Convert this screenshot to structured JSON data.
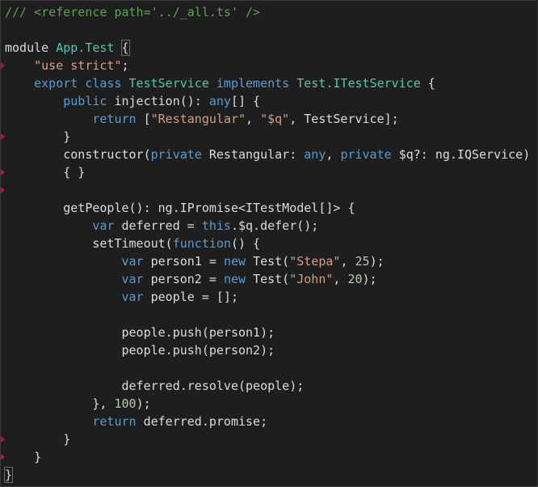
{
  "editor": {
    "colors": {
      "background": "#1e1e1e",
      "comment": "#57a64a",
      "keyword": "#569cd6",
      "string": "#d69d85",
      "number": "#b5cea8",
      "type": "#4ec9b0",
      "plain": "#dcdcdc",
      "error_marker": "#c8102e"
    },
    "error_marker_lines": [
      3,
      7,
      9,
      10,
      24,
      25
    ],
    "lines": [
      [
        [
          "comment",
          "/// <reference path='../_all.ts' />"
        ]
      ],
      [],
      [
        [
          "plain",
          "module "
        ],
        [
          "type",
          "App.Test"
        ],
        [
          "plain",
          " {"
        ]
      ],
      [
        [
          "plain",
          "    "
        ],
        [
          "string",
          "\"use strict\""
        ],
        [
          "plain",
          ";"
        ]
      ],
      [
        [
          "plain",
          "    "
        ],
        [
          "keyword",
          "export class "
        ],
        [
          "type",
          "TestService"
        ],
        [
          "keyword",
          " implements "
        ],
        [
          "type",
          "Test.ITestService"
        ],
        [
          "plain",
          " {"
        ]
      ],
      [
        [
          "plain",
          "        "
        ],
        [
          "keyword",
          "public "
        ],
        [
          "plain",
          "injection(): "
        ],
        [
          "keyword",
          "any"
        ],
        [
          "plain",
          "[] {"
        ]
      ],
      [
        [
          "plain",
          "            "
        ],
        [
          "keyword",
          "return "
        ],
        [
          "plain",
          "["
        ],
        [
          "string",
          "\"Restangular\""
        ],
        [
          "plain",
          ", "
        ],
        [
          "string",
          "\"$q\""
        ],
        [
          "plain",
          ", TestService];"
        ]
      ],
      [
        [
          "plain",
          "        }"
        ]
      ],
      [
        [
          "plain",
          "        "
        ],
        [
          "plain",
          "constructor("
        ],
        [
          "keyword",
          "private "
        ],
        [
          "plain",
          "Restangular: "
        ],
        [
          "keyword",
          "any"
        ],
        [
          "plain",
          ", "
        ],
        [
          "keyword",
          "private "
        ],
        [
          "plain",
          "$q?: ng.IQService)"
        ]
      ],
      [
        [
          "plain",
          "        { }"
        ]
      ],
      [],
      [
        [
          "plain",
          "        getPeople(): ng.IPromise<ITestModel[]> {"
        ]
      ],
      [
        [
          "plain",
          "            "
        ],
        [
          "keyword",
          "var "
        ],
        [
          "plain",
          "deferred = "
        ],
        [
          "keyword",
          "this"
        ],
        [
          "plain",
          ".$q.defer();"
        ]
      ],
      [
        [
          "plain",
          "            setTimeout("
        ],
        [
          "keyword",
          "function"
        ],
        [
          "plain",
          "() {"
        ]
      ],
      [
        [
          "plain",
          "                "
        ],
        [
          "keyword",
          "var "
        ],
        [
          "plain",
          "person1 = "
        ],
        [
          "keyword",
          "new "
        ],
        [
          "plain",
          "Test("
        ],
        [
          "string",
          "\"Stepa\""
        ],
        [
          "plain",
          ", "
        ],
        [
          "number",
          "25"
        ],
        [
          "plain",
          ");"
        ]
      ],
      [
        [
          "plain",
          "                "
        ],
        [
          "keyword",
          "var "
        ],
        [
          "plain",
          "person2 = "
        ],
        [
          "keyword",
          "new "
        ],
        [
          "plain",
          "Test("
        ],
        [
          "string",
          "\"John\""
        ],
        [
          "plain",
          ", "
        ],
        [
          "number",
          "20"
        ],
        [
          "plain",
          ");"
        ]
      ],
      [
        [
          "plain",
          "                "
        ],
        [
          "keyword",
          "var "
        ],
        [
          "plain",
          "people = [];"
        ]
      ],
      [],
      [
        [
          "plain",
          "                people.push(person1);"
        ]
      ],
      [
        [
          "plain",
          "                people.push(person2);"
        ]
      ],
      [],
      [
        [
          "plain",
          "                deferred.resolve(people);"
        ]
      ],
      [
        [
          "plain",
          "            }, "
        ],
        [
          "number",
          "100"
        ],
        [
          "plain",
          ");"
        ]
      ],
      [
        [
          "plain",
          "            "
        ],
        [
          "keyword",
          "return "
        ],
        [
          "plain",
          "deferred.promise;"
        ]
      ],
      [
        [
          "plain",
          "        }"
        ]
      ],
      [
        [
          "plain",
          "    }"
        ]
      ],
      [
        [
          "plain",
          "}"
        ]
      ]
    ]
  }
}
